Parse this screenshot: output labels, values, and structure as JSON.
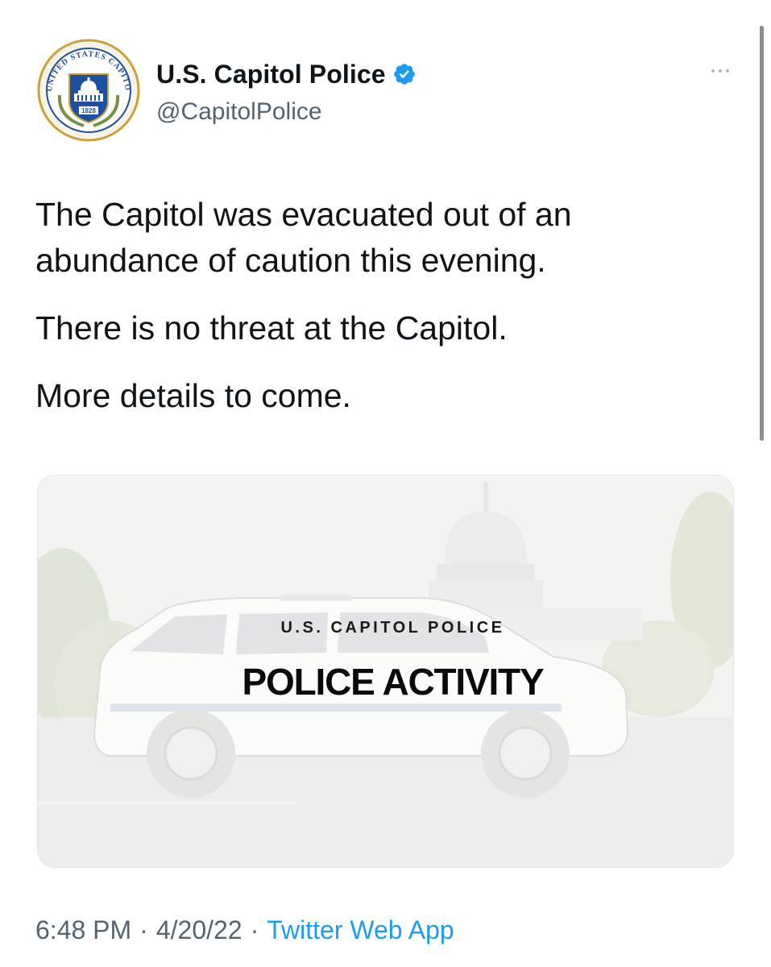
{
  "tweet": {
    "author": {
      "display_name": "U.S. Capitol Police",
      "handle": "@CapitolPolice",
      "verified": true,
      "avatar_icon": "capitol-police-badge-icon",
      "badge_text": {
        "ring": "UNITED STATES CAPITOL POLICE",
        "year": "1828"
      }
    },
    "more_icon": "more-options-icon",
    "paragraphs": [
      "The Capitol was evacuated out of an abundance of caution this evening.",
      "There is no threat at the Capitol.",
      "More details to come."
    ],
    "media": {
      "subtitle": "U.S. CAPITOL POLICE",
      "title": "POLICE ACTIVITY"
    },
    "meta": {
      "time": "6:48 PM",
      "date": "4/20/22",
      "separator": "·",
      "source": "Twitter Web App"
    }
  },
  "colors": {
    "text_primary": "#0f1419",
    "text_secondary": "#536471",
    "link": "#1d9bf0",
    "verified": "#1d9bf0",
    "badge_blue": "#1f4fa0",
    "badge_gold": "#c9a23a"
  }
}
